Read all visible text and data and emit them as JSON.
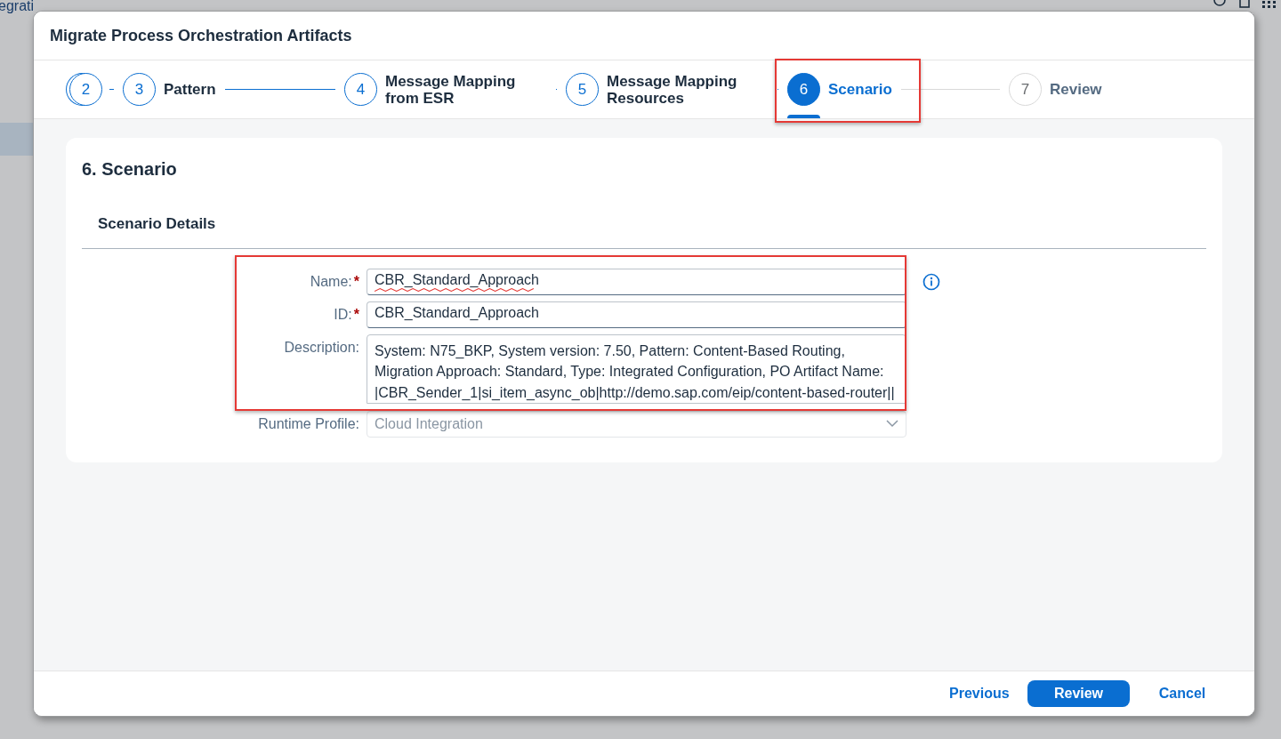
{
  "background": {
    "app_title": "egrati"
  },
  "dialog": {
    "title": "Migrate Process Orchestration Artifacts"
  },
  "steps": [
    {
      "number": "2",
      "completed": true,
      "stacked": true,
      "highlighted": false,
      "selected": false
    },
    {
      "number": "3",
      "label": "Pattern",
      "completed": true,
      "stacked": false,
      "highlighted": false,
      "selected": false
    },
    {
      "number": "4",
      "label": "Message Mapping from ESR",
      "completed": true,
      "stacked": false,
      "highlighted": false,
      "selected": false
    },
    {
      "number": "5",
      "label": "Message Mapping Resources",
      "completed": true,
      "stacked": false,
      "highlighted": false,
      "selected": false
    },
    {
      "number": "6",
      "label": "Scenario",
      "completed": false,
      "stacked": false,
      "highlighted": true,
      "selected": true
    },
    {
      "number": "7",
      "label": "Review",
      "completed": false,
      "stacked": false,
      "highlighted": false,
      "selected": false
    }
  ],
  "page": {
    "heading": "6. Scenario",
    "section_title": "Scenario Details"
  },
  "form": {
    "highlighted": true,
    "fields": [
      {
        "kind": "input",
        "label": "Name:",
        "required": true,
        "required_mark": "*",
        "value": "CBR_Standard_Approach",
        "spelling_error": true,
        "info": true
      },
      {
        "kind": "input",
        "label": "ID:",
        "required": true,
        "required_mark": "*",
        "value": "CBR_Standard_Approach",
        "spelling_error": false,
        "info": false
      },
      {
        "kind": "textarea",
        "label": "Description:",
        "required": false,
        "value": "System: N75_BKP, System version: 7.50, Pattern: Content-Based Routing, Migration Approach: Standard, Type: Integrated Configuration, PO Artifact Name: |CBR_Sender_1|si_item_async_ob|http://demo.sap.com/eip/content-based-router||",
        "spelling_error": false,
        "info": false
      }
    ],
    "runtime_profile": {
      "label": "Runtime Profile:",
      "value": "Cloud Integration",
      "disabled": true
    }
  },
  "footer": {
    "buttons": [
      {
        "label": "Previous",
        "kind": "link"
      },
      {
        "label": "Review",
        "kind": "emphasized"
      },
      {
        "label": "Cancel",
        "kind": "link"
      }
    ]
  }
}
